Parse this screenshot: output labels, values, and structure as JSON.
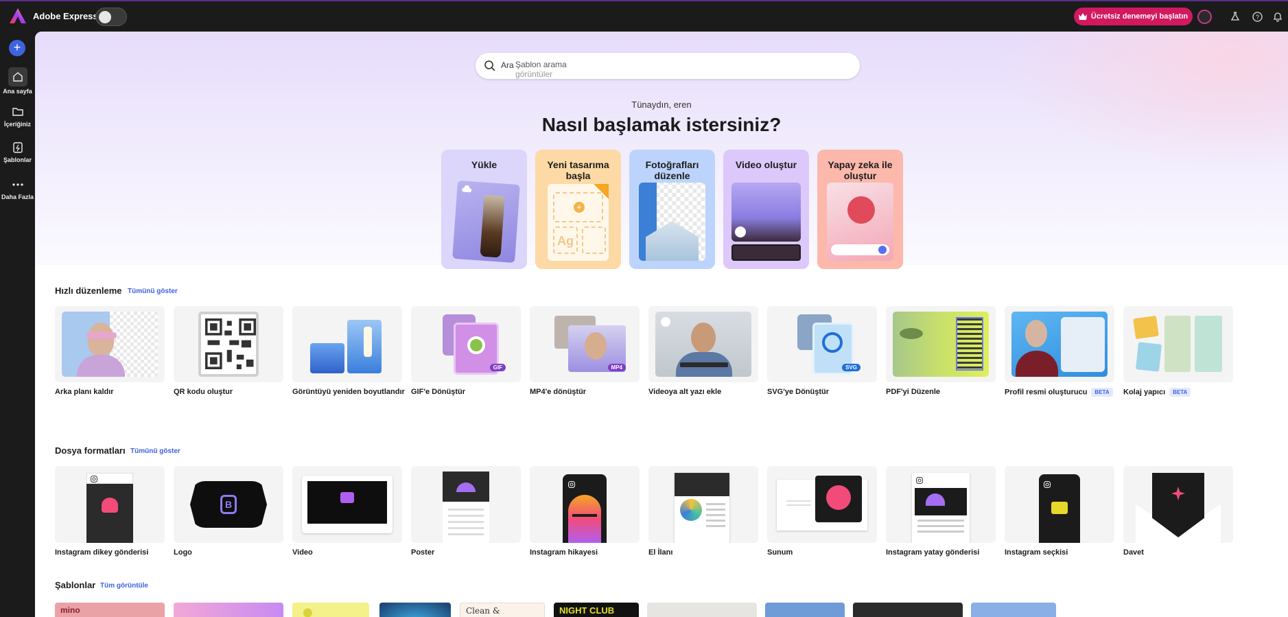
{
  "app": {
    "title": "Adobe Express"
  },
  "topbar": {
    "trial_label": "Ücretsiz denemeyi başlatın"
  },
  "rail": {
    "items": [
      {
        "label": "Ana sayfa"
      },
      {
        "label": "İçeriğiniz"
      },
      {
        "label": "Şablonlar"
      },
      {
        "label": "Daha Fazla"
      }
    ]
  },
  "search": {
    "prefix": "Ara",
    "placeholder": "Şablon arama",
    "placeholder_cycle": "görüntüler"
  },
  "hero": {
    "greeting": "Tünaydın, eren",
    "headline": "Nasıl başlamak istersiniz?"
  },
  "start_cards": [
    {
      "label": "Yükle",
      "color": "#dcd6fb"
    },
    {
      "label": "Yeni tasarıma başla",
      "color": "#fdd9a6"
    },
    {
      "label": "Fotoğrafları düzenle",
      "color": "#bcd4fb"
    },
    {
      "label": "Video oluştur",
      "color": "#dcc8fb"
    },
    {
      "label": "Yapay zeka ile oluştur",
      "color": "#fbb8ab"
    }
  ],
  "quick_edit": {
    "title": "Hızlı düzenleme",
    "link": "Tümünü göster",
    "items": [
      {
        "label": "Arka planı kaldır",
        "beta": ""
      },
      {
        "label": "QR kodu oluştur",
        "beta": ""
      },
      {
        "label": "Görüntüyü yeniden boyutlandır",
        "beta": ""
      },
      {
        "label": "GIF'e Dönüştür",
        "beta": "",
        "badge": "GIF"
      },
      {
        "label": "MP4'e dönüştür",
        "beta": "",
        "badge": "MP4"
      },
      {
        "label": "Videoya alt yazı ekle",
        "beta": ""
      },
      {
        "label": "SVG'ye Dönüştür",
        "beta": "",
        "badge": "SVG"
      },
      {
        "label": "PDF'yi Düzenle",
        "beta": ""
      },
      {
        "label": "Profil resmi oluşturucu",
        "beta": "BETA"
      },
      {
        "label": "Kolaj yapıcı",
        "beta": "BETA"
      }
    ]
  },
  "file_formats": {
    "title": "Dosya formatları",
    "link": "Tümünü göster",
    "items": [
      {
        "label": "Instagram dikey gönderisi"
      },
      {
        "label": "Logo"
      },
      {
        "label": "Video"
      },
      {
        "label": "Poster"
      },
      {
        "label": "Instagram hikayesi"
      },
      {
        "label": "El İlanı"
      },
      {
        "label": "Sunum"
      },
      {
        "label": "Instagram yatay gönderisi"
      },
      {
        "label": "Instagram seçkisi"
      },
      {
        "label": "Davet"
      }
    ]
  },
  "templates": {
    "title": "Şablonlar",
    "link": "Tüm görüntüle",
    "items": [
      {
        "text": "mino",
        "color": "#e9a3a6"
      },
      {
        "text": "",
        "color": "#f2a8d6"
      },
      {
        "text": "",
        "color": "#f4f08a"
      },
      {
        "text": "",
        "color": "#1b3a6b"
      },
      {
        "text": "Clean &",
        "color": "#fbf3ea"
      },
      {
        "text": "NIGHT CLUB",
        "color": "#111111"
      },
      {
        "text": "",
        "color": "#e7e5e1"
      },
      {
        "text": "",
        "color": "#6f9bd6"
      },
      {
        "text": "",
        "color": "#2b2b2b"
      },
      {
        "text": "",
        "color": "#8aaee6"
      }
    ]
  }
}
